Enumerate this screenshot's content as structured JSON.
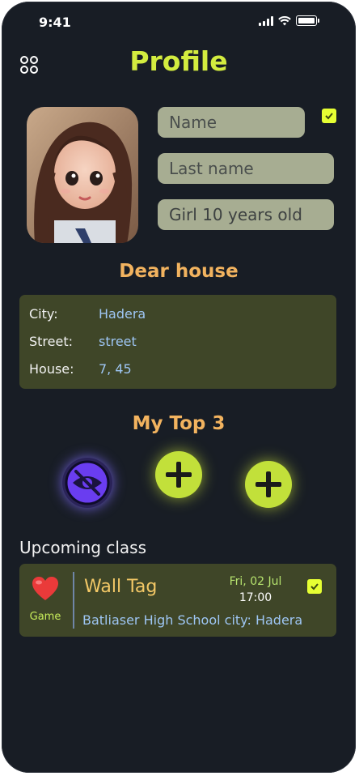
{
  "status_bar": {
    "time": "9:41"
  },
  "header": {
    "title": "Profile",
    "menu_icon": "grid-icon"
  },
  "profile": {
    "name_placeholder": "Name",
    "lastname_placeholder": "Last name",
    "age_value": "Girl 10 years old",
    "checked": true
  },
  "address": {
    "title": "Dear house",
    "rows": [
      {
        "label": "City:",
        "value": "Hadera"
      },
      {
        "label": "Street:",
        "value": "street"
      },
      {
        "label": "House:",
        "value": "7, 45"
      }
    ]
  },
  "top3": {
    "title": "My Top 3",
    "items": [
      "hidden-eye-icon",
      "plus-icon",
      "plus-icon"
    ]
  },
  "upcoming": {
    "label": "Upcoming class",
    "category": "Game",
    "title": "Wall Tag",
    "date": "Fri, 02 Jul",
    "time": "17:00",
    "location": "Batliaser High School city: Hadera",
    "checked": true
  },
  "colors": {
    "background": "#181d25",
    "accent": "#d3ec3f",
    "section_title": "#f2b35f",
    "card": "#3f4628",
    "link": "#9ec6f4"
  }
}
